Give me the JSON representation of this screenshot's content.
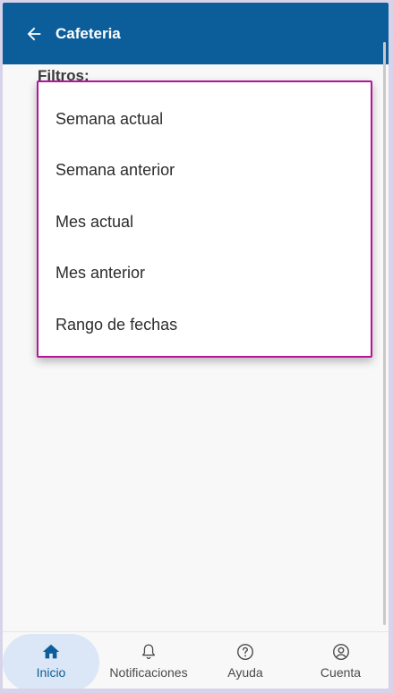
{
  "appbar": {
    "back_icon": "arrow-left-icon",
    "title": "Cafeteria"
  },
  "filters": {
    "label": "Filtros:",
    "options": [
      "Semana actual",
      "Semana anterior",
      "Mes actual",
      "Mes anterior",
      "Rango de fechas"
    ]
  },
  "bottom_nav": {
    "items": [
      {
        "label": "Inicio",
        "icon": "home-icon",
        "active": true
      },
      {
        "label": "Notificaciones",
        "icon": "bell-icon",
        "active": false
      },
      {
        "label": "Ayuda",
        "icon": "help-circle-icon",
        "active": false
      },
      {
        "label": "Cuenta",
        "icon": "user-circle-icon",
        "active": false
      }
    ]
  },
  "colors": {
    "appbar": "#0c5e9a",
    "dropdown_border": "#b5149b",
    "active_pill": "#dbe7f6"
  }
}
